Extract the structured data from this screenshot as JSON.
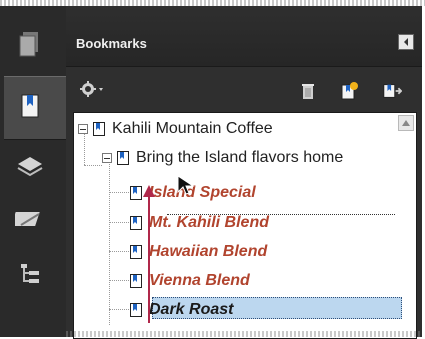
{
  "panel": {
    "title": "Bookmarks"
  },
  "left_rail": {
    "items": [
      {
        "name": "pages-icon"
      },
      {
        "name": "bookmarks-icon"
      },
      {
        "name": "layers-icon"
      },
      {
        "name": "signatures-icon"
      },
      {
        "name": "model-tree-icon"
      }
    ]
  },
  "toolbar": {
    "options_menu": "options",
    "delete_icon": "trash-icon",
    "new_bookmark_icon": "new-bookmark-icon",
    "expand_icon": "expand-bookmark-icon"
  },
  "tree": {
    "root": "Kahili Mountain Coffee",
    "child": "Bring the Island flavors home",
    "items": [
      "Island Special",
      "Mt. Kahili Blend",
      "Hawaiian Blend",
      "Vienna Blend",
      "Dark Roast"
    ],
    "selected_index": 4
  },
  "colors": {
    "rail_bg": "#2a2a2a",
    "panel_bg": "#2f2f2f",
    "item_text": "#b1442e",
    "selection_bg": "#bcd7ef",
    "drag_arrow": "#b0284a"
  }
}
